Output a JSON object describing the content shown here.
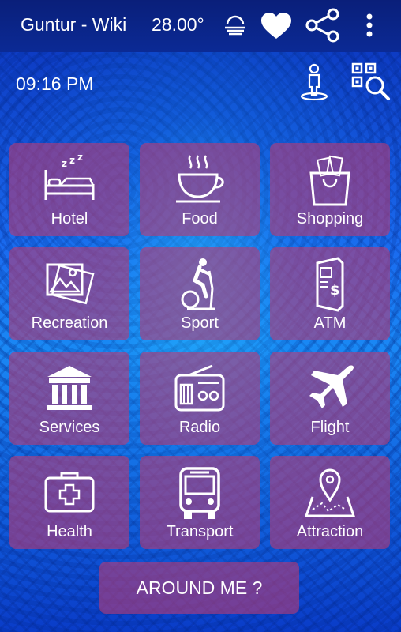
{
  "header": {
    "title": "Guntur - Wiki",
    "temperature": "28.00°",
    "weather_icon": "fog-icon",
    "favorite_icon": "heart-icon",
    "share_icon": "share-icon",
    "menu_icon": "more-vert-icon"
  },
  "status": {
    "time": "09:16 PM",
    "person_icon": "person-location-icon",
    "qr_icon": "qr-scan-icon"
  },
  "tiles": [
    {
      "label": "Hotel",
      "icon": "bed-icon"
    },
    {
      "label": "Food",
      "icon": "coffee-cup-icon"
    },
    {
      "label": "Shopping",
      "icon": "shopping-bag-icon"
    },
    {
      "label": "Recreation",
      "icon": "pictures-icon"
    },
    {
      "label": "Sport",
      "icon": "exercise-bike-icon"
    },
    {
      "label": "ATM",
      "icon": "atm-icon"
    },
    {
      "label": "Services",
      "icon": "building-icon"
    },
    {
      "label": "Radio",
      "icon": "radio-icon"
    },
    {
      "label": "Flight",
      "icon": "airplane-icon"
    },
    {
      "label": "Health",
      "icon": "first-aid-icon"
    },
    {
      "label": "Transport",
      "icon": "bus-icon"
    },
    {
      "label": "Attraction",
      "icon": "map-pin-icon"
    }
  ],
  "around_me": {
    "label": "AROUND ME ?"
  },
  "colors": {
    "appbar": "#0b2a95",
    "tile": "#b43c78",
    "text": "#ffffff"
  }
}
